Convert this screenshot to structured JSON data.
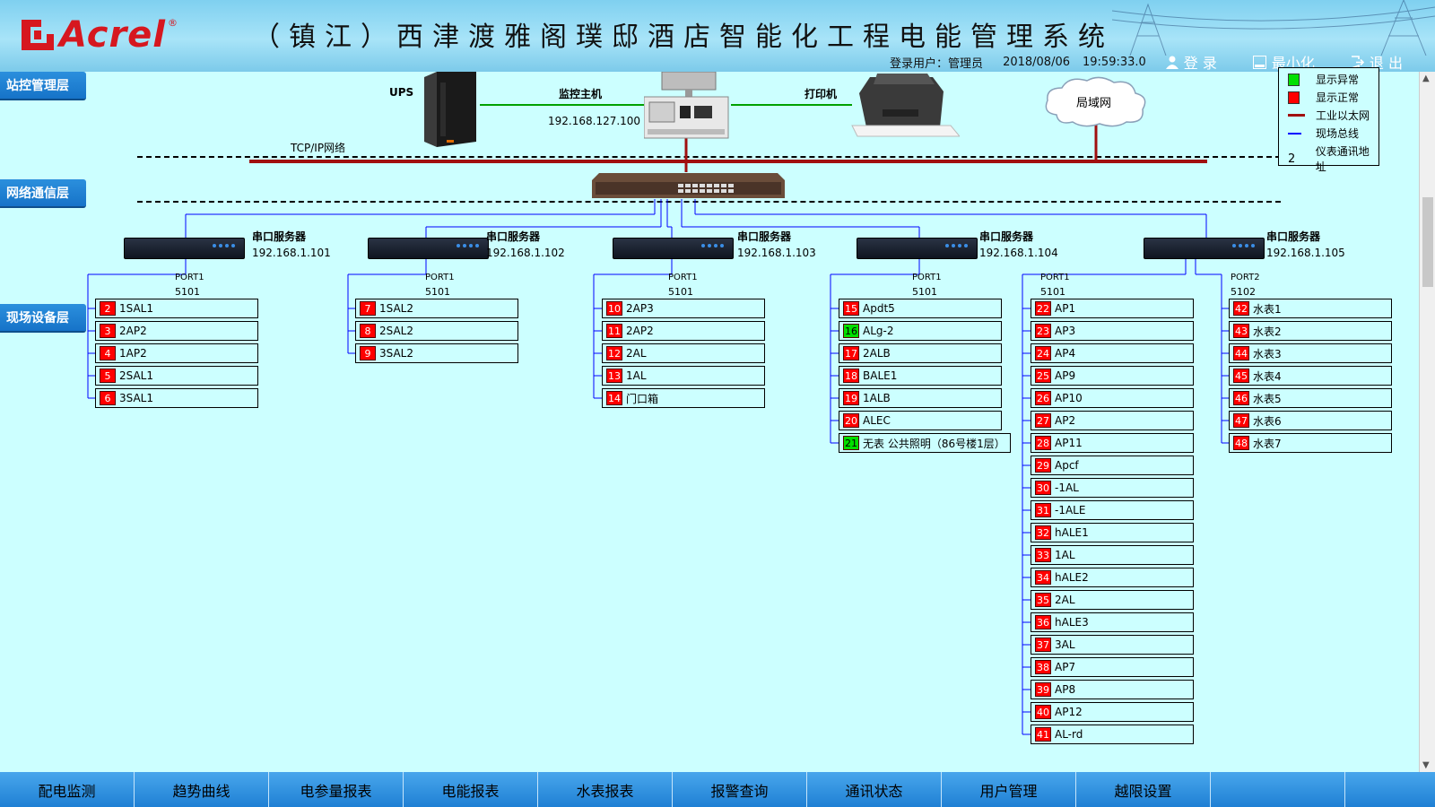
{
  "header": {
    "logo_text": "Acrel",
    "logo_reg": "®",
    "title": "（镇江）西津渡雅阁璞邸酒店智能化工程电能管理系统",
    "login_label": "登录用户：",
    "user": "管理员",
    "date": "2018/08/06",
    "time": "19:59:33.0",
    "btn_login": "登 录",
    "btn_minimize": "最小化",
    "btn_exit": "退 出"
  },
  "layers": {
    "station": "站控管理层",
    "network": "网络通信层",
    "field": "现场设备层"
  },
  "station": {
    "ups_label": "UPS",
    "host_label": "监控主机",
    "host_ip": "192.168.127.100",
    "printer_label": "打印机",
    "lan_label": "局域网",
    "tcpip_label": "TCP/IP网络"
  },
  "legend": {
    "items": [
      {
        "label": "显示异常",
        "color": "#00e000"
      },
      {
        "label": "显示正常",
        "color": "#ff0000"
      },
      {
        "label": "工业以太网",
        "color": "#a01010"
      },
      {
        "label": "现场总线",
        "color": "#0000ff"
      },
      {
        "label": "仪表通讯地址",
        "symbol": "2"
      }
    ]
  },
  "servers": [
    {
      "name": "串口服务器",
      "ip": "192.168.1.101",
      "port": "PORT1",
      "port_num": "5101"
    },
    {
      "name": "串口服务器",
      "ip": "192.168.1.102",
      "port": "PORT1",
      "port_num": "5101"
    },
    {
      "name": "串口服务器",
      "ip": "192.168.1.103",
      "port": "PORT1",
      "port_num": "5101"
    },
    {
      "name": "串口服务器",
      "ip": "192.168.1.104",
      "port": "PORT1",
      "port_num": "5101"
    },
    {
      "name": "串口服务器",
      "ip": "192.168.1.105",
      "port": "PORT1",
      "port_num": "5101",
      "port2": "PORT2",
      "port2_num": "5102"
    }
  ],
  "device_groups": [
    {
      "devices": [
        {
          "addr": "2",
          "name": "1SAL1",
          "status": "red"
        },
        {
          "addr": "3",
          "name": "2AP2",
          "status": "red"
        },
        {
          "addr": "4",
          "name": "1AP2",
          "status": "red"
        },
        {
          "addr": "5",
          "name": "2SAL1",
          "status": "red"
        },
        {
          "addr": "6",
          "name": "3SAL1",
          "status": "red"
        }
      ]
    },
    {
      "devices": [
        {
          "addr": "7",
          "name": "1SAL2",
          "status": "red"
        },
        {
          "addr": "8",
          "name": "2SAL2",
          "status": "red"
        },
        {
          "addr": "9",
          "name": "3SAL2",
          "status": "red"
        }
      ]
    },
    {
      "devices": [
        {
          "addr": "10",
          "name": "2AP3",
          "status": "red"
        },
        {
          "addr": "11",
          "name": "2AP2",
          "status": "red"
        },
        {
          "addr": "12",
          "name": "2AL",
          "status": "red"
        },
        {
          "addr": "13",
          "name": "1AL",
          "status": "red"
        },
        {
          "addr": "14",
          "name": "门口箱",
          "status": "red"
        }
      ]
    },
    {
      "devices": [
        {
          "addr": "15",
          "name": "Apdt5",
          "status": "red"
        },
        {
          "addr": "16",
          "name": "ALg-2",
          "status": "green"
        },
        {
          "addr": "17",
          "name": "2ALB",
          "status": "red"
        },
        {
          "addr": "18",
          "name": "BALE1",
          "status": "red"
        },
        {
          "addr": "19",
          "name": "1ALB",
          "status": "red"
        },
        {
          "addr": "20",
          "name": "ALEC",
          "status": "red"
        },
        {
          "addr": "21",
          "name": "无表 公共照明（86号楼1层）",
          "status": "green"
        }
      ]
    },
    {
      "devices": [
        {
          "addr": "22",
          "name": "AP1",
          "status": "red"
        },
        {
          "addr": "23",
          "name": "AP3",
          "status": "red"
        },
        {
          "addr": "24",
          "name": "AP4",
          "status": "red"
        },
        {
          "addr": "25",
          "name": "AP9",
          "status": "red"
        },
        {
          "addr": "26",
          "name": "AP10",
          "status": "red"
        },
        {
          "addr": "27",
          "name": "AP2",
          "status": "red"
        },
        {
          "addr": "28",
          "name": "AP11",
          "status": "red"
        },
        {
          "addr": "29",
          "name": "Apcf",
          "status": "red"
        },
        {
          "addr": "30",
          "name": "-1AL",
          "status": "red"
        },
        {
          "addr": "31",
          "name": "-1ALE",
          "status": "red"
        },
        {
          "addr": "32",
          "name": "hALE1",
          "status": "red"
        },
        {
          "addr": "33",
          "name": "1AL",
          "status": "red"
        },
        {
          "addr": "34",
          "name": "hALE2",
          "status": "red"
        },
        {
          "addr": "35",
          "name": "2AL",
          "status": "red"
        },
        {
          "addr": "36",
          "name": "hALE3",
          "status": "red"
        },
        {
          "addr": "37",
          "name": "3AL",
          "status": "red"
        },
        {
          "addr": "38",
          "name": "AP7",
          "status": "red"
        },
        {
          "addr": "39",
          "name": "AP8",
          "status": "red"
        },
        {
          "addr": "40",
          "name": "AP12",
          "status": "red"
        },
        {
          "addr": "41",
          "name": "AL-rd",
          "status": "red"
        }
      ]
    },
    {
      "devices": [
        {
          "addr": "42",
          "name": "水表1",
          "status": "red"
        },
        {
          "addr": "43",
          "name": "水表2",
          "status": "red"
        },
        {
          "addr": "44",
          "name": "水表3",
          "status": "red"
        },
        {
          "addr": "45",
          "name": "水表4",
          "status": "red"
        },
        {
          "addr": "46",
          "name": "水表5",
          "status": "red"
        },
        {
          "addr": "47",
          "name": "水表6",
          "status": "red"
        },
        {
          "addr": "48",
          "name": "水表7",
          "status": "red"
        }
      ]
    }
  ],
  "nav": [
    "配电监测",
    "趋势曲线",
    "电参量报表",
    "电能报表",
    "水表报表",
    "报警查询",
    "通讯状态",
    "用户管理",
    "越限设置",
    "",
    ""
  ]
}
